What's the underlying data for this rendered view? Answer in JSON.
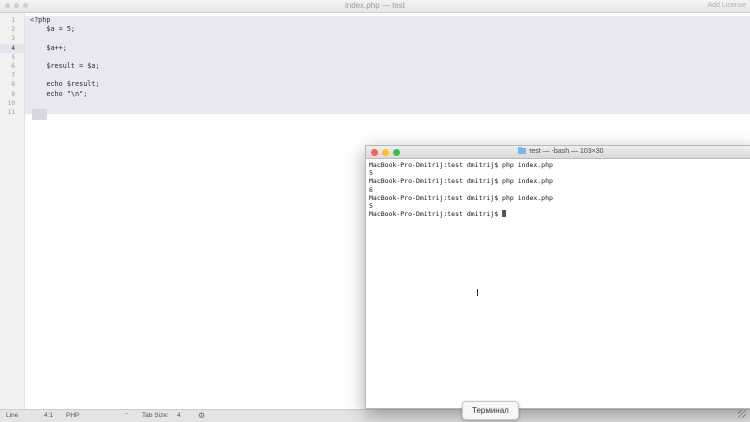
{
  "editor": {
    "title": "index.php — test",
    "license_label": "Add License",
    "line_numbers": [
      "1",
      "2",
      "3",
      "4",
      "5",
      "6",
      "7",
      "8",
      "9",
      "10",
      "11"
    ],
    "current_line": "4",
    "code_lines": [
      "<?php",
      "    $a = 5;",
      "",
      "    $a++;",
      "",
      "    $result = $a;",
      "",
      "    echo $result;",
      "    echo \"\\n\";",
      "",
      ""
    ]
  },
  "statusbar": {
    "line_label": "Line",
    "position": "4:1",
    "syntax": "PHP",
    "tab_size_label": "Tab Size:",
    "tab_size_value": "4"
  },
  "terminal": {
    "title": "test — -bash — 103×30",
    "lines": [
      "MacBook-Pro-Dmitrij:test dmitrij$ php index.php",
      "5",
      "MacBook-Pro-Dmitrij:test dmitrij$ php index.php",
      "6",
      "MacBook-Pro-Dmitrij:test dmitrij$ php index.php",
      "5",
      "MacBook-Pro-Dmitrij:test dmitrij$ "
    ],
    "colors": {
      "close": "#ff5f57",
      "minimize": "#febc2e",
      "zoom": "#28c840"
    }
  },
  "tooltip": {
    "text": "Терминал"
  }
}
